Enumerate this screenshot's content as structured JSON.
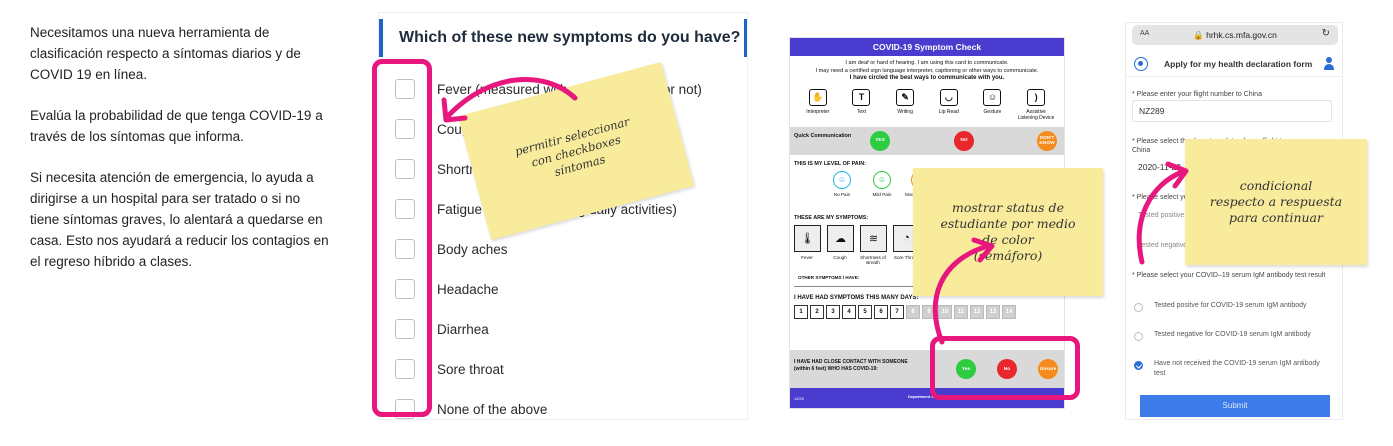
{
  "description": {
    "paragraphs": [
      "Necesitamos una nueva herramienta de clasificación respecto a síntomas diarios y de COVID 19 en línea.",
      "Evalúa la probabilidad de que tenga COVID-19 a través de los síntomas que informa.",
      "Si necesita atención de emergencia, lo ayuda a dirigirse a un hospital para ser tratado o si no tiene síntomas graves, lo alentará a quedarse en casa. Esto nos ayudará a reducir los contagios en el regreso híbrido a clases."
    ]
  },
  "symptom_form": {
    "title": "Which of these new symptoms do you have?",
    "options": [
      "Fever (measured with a thermometer or not)",
      "Cough (new or worsening)",
      "Shortness of breath",
      "Fatigue (new or affecting daily activities)",
      "Body aches",
      "Headache",
      "Diarrhea",
      "Sore throat",
      "None of the above"
    ],
    "checked": []
  },
  "covid_card": {
    "title": "COVID-19 Symptom Check",
    "intro_line1": "I am deaf or hard of hearing. I am using this card to communicate.",
    "intro_line2": "I may need a certified sign language interpreter, captioning or other ways to communicate.",
    "intro_line3": "I have circled the best ways to communicate with you.",
    "communication": [
      {
        "label": "Interpreter",
        "icon": "interpreter-icon",
        "glyph": "✋"
      },
      {
        "label": "Text",
        "icon": "text-icon",
        "glyph": "T"
      },
      {
        "label": "Writing",
        "icon": "writing-icon",
        "glyph": "✎"
      },
      {
        "label": "Lip Read",
        "icon": "lip-read-icon",
        "glyph": "◡"
      },
      {
        "label": "Gesture",
        "icon": "gesture-icon",
        "glyph": "☺"
      },
      {
        "label": "Assistive Listening Device",
        "icon": "assistive-listening-icon",
        "glyph": ")"
      }
    ],
    "quick_label": "Quick Communication",
    "quick_yes": "YES",
    "quick_no": "NO",
    "quick_dont_know": "DON'T KNOW",
    "pain_title": "THIS IS MY LEVEL OF PAIN:",
    "pain_levels": [
      "No Pain",
      "Mild Pain",
      "Moderate Pain"
    ],
    "symptoms_title": "THESE ARE MY SYMPTOMS:",
    "symptom_icons": [
      "Fever",
      "Cough",
      "Shortness of Breath",
      "Sore Throat"
    ],
    "other_symptoms": "OTHER SYMPTOMS I HAVE:",
    "days_title": "I HAVE HAD SYMPTOMS THIS MANY DAYS:",
    "days": [
      "1",
      "2",
      "3",
      "4",
      "5",
      "6",
      "7",
      "8",
      "9",
      "10",
      "11",
      "12",
      "13",
      "14"
    ],
    "contact_label": "I HAVE HAD CLOSE CONTACT WITH SOMEONE (within 6 feet) WHO HAS COVID-19:",
    "contact_yes": "Yes",
    "contact_no": "No",
    "contact_unsure": "Unsure",
    "footer_code": "12/20",
    "footer_brand": "Department of Health"
  },
  "mobile_form": {
    "browser_aa": "AA",
    "url": "hrhk.cs.mfa.gov.cn",
    "header_title": "Apply for my health declaration form",
    "flight_label": "* Please enter your flight number to China",
    "flight_value": "NZ289",
    "date_label_line1": "* Please select the departure date of your flight to",
    "date_label_line2": "China",
    "date_value": "2020-11-22",
    "nucleic_label": "* Please select your nucleic acid test result",
    "nucleic_opt1": "Tested positive",
    "nucleic_opt2": "Tested negative",
    "igm_label": "* Please select your COVID–19 serum IgM antibody test result",
    "igm_options": [
      "Tested positve for COVID-19 serum IgM antibody",
      "Tested negative for COVID-19 serum IgM antibody",
      "Have not received the COVID-19 serum IgM antibody test"
    ],
    "igm_selected": 2,
    "submit_label": "Submit"
  },
  "notes": {
    "note1_lines": [
      "permitir seleccionar",
      "con checkboxes",
      "síntomas"
    ],
    "note2_lines": [
      "mostrar status de",
      "estudiante por medio",
      "de color",
      "(semáforo)"
    ],
    "note3_lines": [
      "condicional",
      "respecto a respuesta",
      "para continuar"
    ]
  },
  "colors": {
    "accent_blue": "#1f63c6",
    "card_purple": "#4a3ccf",
    "highlight_pink": "#e8177e",
    "sticky_yellow": "#f8eb9c",
    "yes_green": "#2ecc40",
    "no_red": "#e8262b",
    "unsure_orange": "#f68b1e",
    "submit_blue": "#3d7ce8"
  }
}
